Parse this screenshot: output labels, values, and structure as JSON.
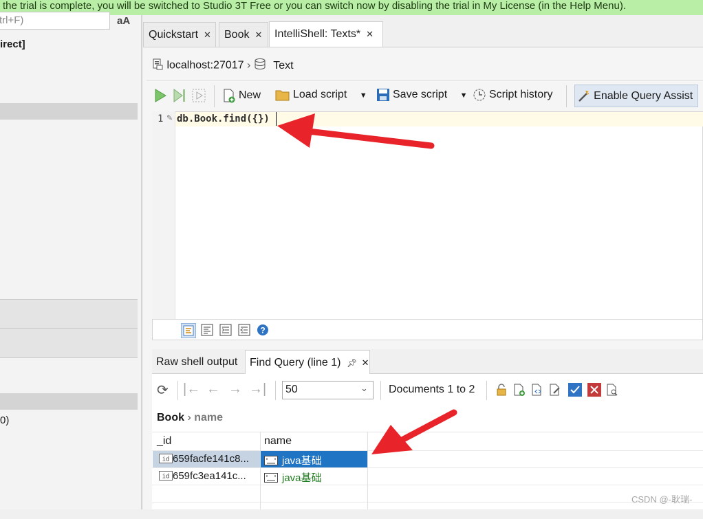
{
  "banner": {
    "text": " the trial is complete, you will be switched to Studio 3T Free or you can switch now by disabling the trial in My License (in the Help Menu)."
  },
  "left": {
    "search_placeholder": "trl+F)",
    "font_toggle": "aA",
    "connection_label": "irect]",
    "count_fragment": "0)"
  },
  "tabs": [
    {
      "label": "Quickstart",
      "close": "✕"
    },
    {
      "label": "Book",
      "close": "✕"
    },
    {
      "label": "IntelliShell: Texts*",
      "close": "✕"
    }
  ],
  "breadcrumb": {
    "server": "localhost:27017",
    "database": "Text"
  },
  "toolbar": {
    "new": "New",
    "load_script": "Load script",
    "save_script": "Save script",
    "script_history": "Script history",
    "enable_query_assist": "Enable Query Assist"
  },
  "editor": {
    "line_number": "1",
    "code": "db.Book.find({})"
  },
  "result_tabs": {
    "raw": "Raw shell output",
    "find_query": "Find Query (line 1)"
  },
  "result_toolbar": {
    "page_size": "50",
    "doc_count": "Documents 1 to 2"
  },
  "path": {
    "collection": "Book",
    "field": "name"
  },
  "table": {
    "headers": [
      "_id",
      "name"
    ],
    "rows": [
      {
        "id": "659facfe141c8...",
        "name": "java基础"
      },
      {
        "id": "659fc3ea141c...",
        "name": "java基础"
      }
    ]
  },
  "watermark": "CSDN @-耿瑞-",
  "colors": {
    "banner": "#b9eea6",
    "selection": "#1f74c4",
    "annotation_arrow": "#e8232a",
    "value_green": "#1e7c1e"
  }
}
